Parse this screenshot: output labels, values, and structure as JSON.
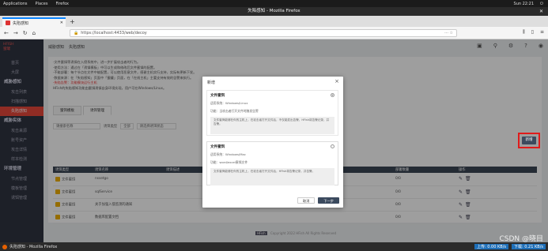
{
  "system": {
    "applications": "Applications",
    "places": "Places",
    "firefox": "Firefox",
    "clock": "Sun 22:21"
  },
  "window": {
    "title": "失陷感知 - Mozilla Firefox",
    "tab_title": "失陷感知",
    "url": "https://localhost:4433/web/decoy"
  },
  "sidebar": {
    "logo_lines": [
      "HFISH",
      "蜜罐"
    ],
    "items": [
      {
        "label": "首页",
        "type": "item"
      },
      {
        "label": "大屏",
        "type": "item"
      },
      {
        "label": "威胁感知",
        "type": "group"
      },
      {
        "label": "攻击列表",
        "type": "item"
      },
      {
        "label": "扫描感知",
        "type": "item"
      },
      {
        "label": "失陷感知",
        "type": "item",
        "active": true
      },
      {
        "label": "威胁实体",
        "type": "group"
      },
      {
        "label": "攻击来源",
        "type": "item"
      },
      {
        "label": "账号资产",
        "type": "item"
      },
      {
        "label": "攻击详情",
        "type": "item"
      },
      {
        "label": "样本检测",
        "type": "item"
      },
      {
        "label": "环境管理",
        "type": "group"
      },
      {
        "label": "节点管理",
        "type": "item"
      },
      {
        "label": "模板管理",
        "type": "item"
      },
      {
        "label": "诱饵管理",
        "type": "item"
      }
    ]
  },
  "breadcrumb": [
    "威胁感知",
    "失陷感知"
  ],
  "notice": {
    "lines": [
      "·文件蜜饵等诱饵在入侵系统中，进一步扩展攻击者的行为。",
      "·使用方法：通过在「诱饵模板」中可以生成和修改后文件蜜饵的配置。",
      "·不能部署：每个节点在文件中被配置，可以使用恶意文件，感谢主机实行支持，实际有更新下发。",
      "·数据来源：在「失陷感知」页面中「蜜罐」页面，在「在线主机」主要支持有效的告警来执行。"
    ],
    "warning": "·失陷告警：功能模块运行主机",
    "footer_line": "HFish的失陷感知功能由蜜饵诱饵自身环境实现，用户可在Windows/Linux。"
  },
  "tabs": [
    {
      "label": "蜜饵模板"
    },
    {
      "label": "诱饵管理",
      "active": true
    }
  ],
  "filters": {
    "search_placeholder": "请搜索名称",
    "type_label": "诱饵类型",
    "type_value": "全部",
    "status_placeholder": "请选择诱饵状态"
  },
  "add_button": "新增",
  "table": {
    "headers": [
      "诱饵类型",
      "诱饵名称",
      "诱饵描述",
      "",
      "",
      "",
      "",
      "",
      "部署数量",
      "",
      "操作"
    ],
    "rows": [
      {
        "type": "文件蜜饵",
        "name": "nssetgo",
        "count": "0/0"
      },
      {
        "type": "文件蜜饵",
        "name": "sqlService",
        "count": "0/0"
      },
      {
        "type": "文件蜜饵",
        "name": "关于加强入侵监测的通知",
        "count": "0/0"
      },
      {
        "type": "文件蜜饵",
        "name": "数据库配置文档",
        "count": "0/0"
      }
    ]
  },
  "footer": {
    "badge": "HFish",
    "text": "Copyright 2022 HFish All Rights Reserved"
  },
  "modal": {
    "title": "新增",
    "options": [
      {
        "title": "文件蜜饵",
        "platform": "适用系统：Windows/Linux",
        "function": "功能：当攻击者打开文件时触发告警",
        "desc": "文件蜜饵能够在你的主机上，在攻击者打开文件后，不仅能发出告警，HFish将告警记录，并告警。",
        "selected": true
      },
      {
        "title": "文件蜜饵",
        "platform": "适用系统：Windows/Mac",
        "function": "功能：word/excel蜜饵文件",
        "desc": "文件蜜饵能够在你的主机上，在攻击者打开文件后，HFish将告警记录，并告警。",
        "selected": false
      }
    ],
    "cancel": "取消",
    "next": "下一步"
  },
  "taskbar": {
    "app": "失陷感知 - Mozilla Firefox",
    "up": "上传: 0.00 KB/s",
    "down": "下载: 0.21 KB/s"
  },
  "watermark": "CSDN @晓目"
}
